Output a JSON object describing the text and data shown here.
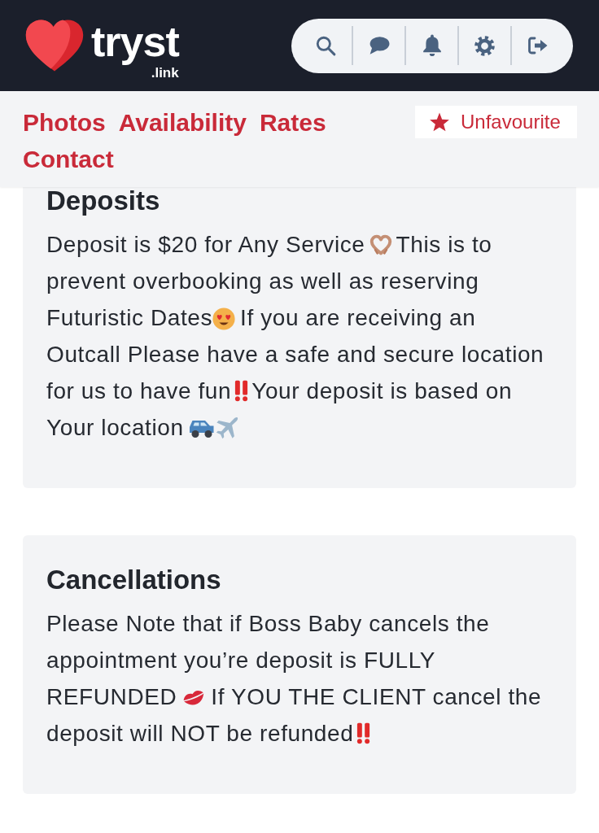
{
  "header": {
    "logo": {
      "wordmark": "tryst",
      "domain": ".link"
    }
  },
  "profile_nav": {
    "links": [
      "Photos",
      "Availability",
      "Rates",
      "Contact"
    ],
    "favourite_button": {
      "label": "Unfavourite"
    }
  },
  "sections": [
    {
      "title": "Deposits",
      "body": [
        {
          "kind": "text",
          "text": "Deposit is $20 for Any Service"
        },
        {
          "kind": "hands"
        },
        {
          "kind": "text",
          "text": "This is to prevent overbooking as well as reserving Futuristic Dates"
        },
        {
          "kind": "smitten"
        },
        {
          "kind": "text",
          "text": "If you are receiving an Outcall Please have a safe and secure location for us to have fun"
        },
        {
          "kind": "alert"
        },
        {
          "kind": "text",
          "text": "Your deposit is based on Your location"
        },
        {
          "kind": "car"
        },
        {
          "kind": "plane"
        }
      ]
    },
    {
      "title": "Cancellations",
      "body": [
        {
          "kind": "text",
          "text": "Please Note that if Boss Baby cancels the appointment you’re deposit is FULLY REFUNDED"
        },
        {
          "kind": "kiss"
        },
        {
          "kind": "text",
          "text": "If YOU THE CLIENT cancel the deposit will NOT be refunded"
        },
        {
          "kind": "alert"
        }
      ]
    }
  ]
}
